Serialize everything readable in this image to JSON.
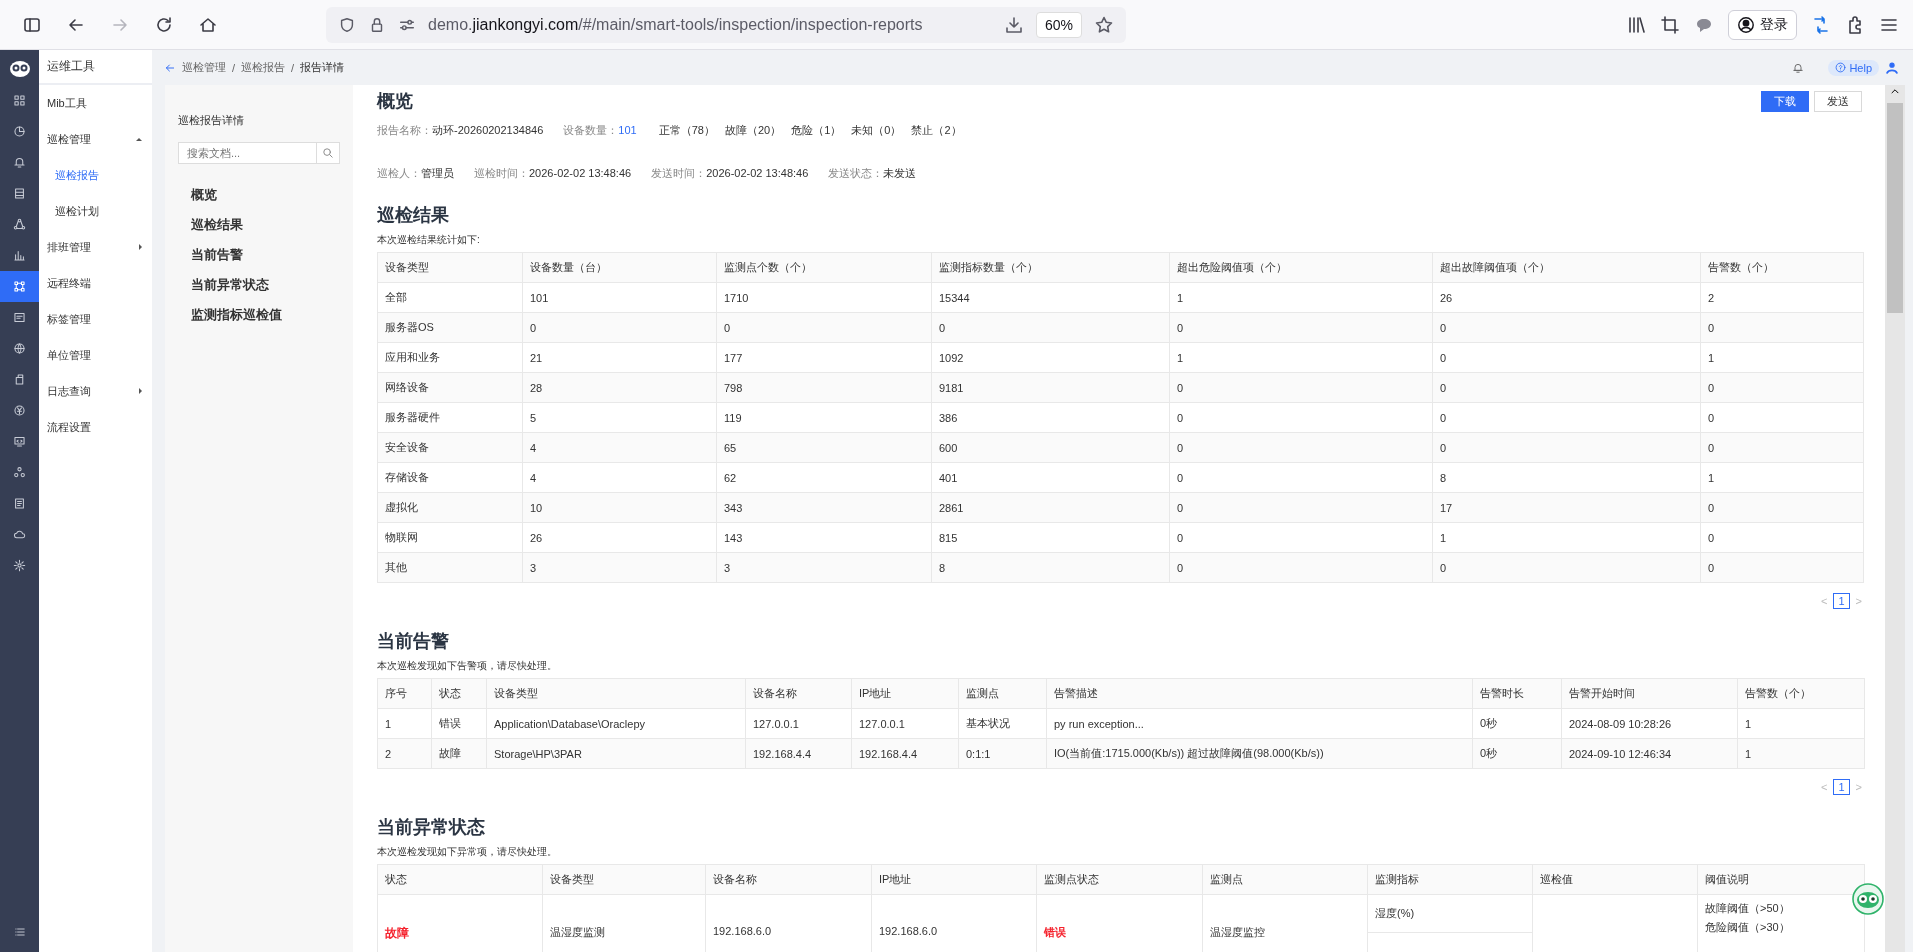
{
  "browser": {
    "url": "demo.**jiankongyi.com**/#/main/smart-tools/inspection/inspection-reports",
    "zoom": "60%",
    "login": "登录"
  },
  "rail": [
    {
      "selected": false
    },
    {
      "selected": false
    },
    {
      "selected": false
    },
    {
      "selected": false
    },
    {
      "selected": false
    },
    {
      "selected": false
    },
    {
      "selected": true
    },
    {
      "selected": false
    },
    {
      "selected": false
    },
    {
      "selected": false
    },
    {
      "selected": false
    },
    {
      "selected": false
    },
    {
      "selected": false
    },
    {
      "selected": false
    },
    {
      "selected": false
    },
    {
      "selected": false
    }
  ],
  "nav": {
    "title": "运维工具",
    "items": [
      {
        "label": "Mib工具",
        "kind": "link"
      },
      {
        "label": "巡检管理",
        "kind": "group",
        "expanded": true,
        "children": [
          {
            "label": "巡检报告",
            "selected": true
          },
          {
            "label": "巡检计划",
            "selected": false
          }
        ]
      },
      {
        "label": "排班管理",
        "kind": "group",
        "expanded": false
      },
      {
        "label": "远程终端",
        "kind": "link"
      },
      {
        "label": "标签管理",
        "kind": "link"
      },
      {
        "label": "单位管理",
        "kind": "link"
      },
      {
        "label": "日志查询",
        "kind": "group",
        "expanded": false
      },
      {
        "label": "流程设置",
        "kind": "link"
      }
    ]
  },
  "breadcrumb": {
    "separator": "/",
    "items": [
      "巡检管理",
      "巡检报告",
      "报告详情"
    ]
  },
  "help": "Help",
  "doc_nav": {
    "title": "巡检报告详情",
    "search": {
      "placeholder": "搜索文档..."
    },
    "items": [
      "概览",
      "巡检结果",
      "当前告警",
      "当前异常状态",
      "监测指标巡检值"
    ]
  },
  "overview": {
    "heading": "概览",
    "buttons": [
      {
        "label": "下载",
        "kind": "primary"
      },
      {
        "label": "发送",
        "kind": "default"
      }
    ],
    "line_1": [
      {
        "label": "报告名称：",
        "value": "动环-20260202134846",
        "kind": "text"
      },
      {
        "label": "设备数量：",
        "value": "101",
        "kind": "link"
      }
    ],
    "counts": [
      "正常（78）",
      "故障（20）",
      "危险（1）",
      "未知（0）",
      "禁止（2）"
    ],
    "line_2": [
      {
        "label": "巡检人：",
        "value": "管理员"
      },
      {
        "label": "巡检时间：",
        "value": "2026-02-02 13:48:46"
      },
      {
        "label": "发送时间：",
        "value": "2026-02-02 13:48:46"
      },
      {
        "label": "发送状态：",
        "value": "未发送"
      }
    ]
  },
  "results": {
    "heading": "巡检结果",
    "note": "本次巡检结果统计如下:",
    "columns": [
      "设备类型",
      "设备数量（台）",
      "监测点个数（个）",
      "监测指标数量（个）",
      "超出危险阈值项（个）",
      "超出故障阈值项（个）",
      "告警数（个）"
    ],
    "rows": [
      [
        "全部",
        "101",
        "1710",
        "15344",
        "1",
        "26",
        "2"
      ],
      [
        "服务器OS",
        "0",
        "0",
        "0",
        "0",
        "0",
        "0"
      ],
      [
        "应用和业务",
        "21",
        "177",
        "1092",
        "1",
        "0",
        "1"
      ],
      [
        "网络设备",
        "28",
        "798",
        "9181",
        "0",
        "0",
        "0"
      ],
      [
        "服务器硬件",
        "5",
        "119",
        "386",
        "0",
        "0",
        "0"
      ],
      [
        "安全设备",
        "4",
        "65",
        "600",
        "0",
        "0",
        "0"
      ],
      [
        "存储设备",
        "4",
        "62",
        "401",
        "0",
        "8",
        "1"
      ],
      [
        "虚拟化",
        "10",
        "343",
        "2861",
        "0",
        "17",
        "0"
      ],
      [
        "物联网",
        "26",
        "143",
        "815",
        "0",
        "1",
        "0"
      ],
      [
        "其他",
        "3",
        "3",
        "8",
        "0",
        "0",
        "0"
      ]
    ],
    "pagination": {
      "prev": "<",
      "pages": [
        {
          "label": "1",
          "selected": true
        }
      ],
      "next": ">"
    }
  },
  "alerts": {
    "heading": "当前告警",
    "note": "本次巡检发现如下告警项，请尽快处理。",
    "columns": [
      "序号",
      "状态",
      "设备类型",
      "设备名称",
      "IP地址",
      "监测点",
      "告警描述",
      "告警时长",
      "告警开始时间",
      "告警数（个）"
    ],
    "rows": [
      [
        "1",
        "错误",
        "Application\\Database\\Oraclepy",
        "127.0.0.1",
        "127.0.0.1",
        "基本状况",
        "py run exception...",
        "0秒",
        "2024-08-09 10:28:26",
        "1"
      ],
      [
        "2",
        "故障",
        "Storage\\HP\\3PAR",
        "192.168.4.4",
        "192.168.4.4",
        "0:1:1",
        "IO(当前值:1715.000(Kb/s)) 超过故障阈值(98.000(Kb/s))",
        "0秒",
        "2024-09-10 12:46:34",
        "1"
      ]
    ],
    "pagination": {
      "prev": "<",
      "pages": [
        {
          "label": "1",
          "selected": true
        }
      ],
      "next": ">"
    }
  },
  "anomalies": {
    "heading": "当前异常状态",
    "note": "本次巡检发现如下异常项，请尽快处理。",
    "columns": [
      "状态",
      "设备类型",
      "设备名称",
      "IP地址",
      "监测点状态",
      "监测点",
      "监测指标",
      "巡检值",
      "阈值说明"
    ],
    "rows": [
      {
        "status": {
          "text": "故障",
          "color": "#f5222d"
        },
        "device_type": "温湿度监测",
        "device_name": "192.168.6.0",
        "ip": "192.168.6.0",
        "point_status": {
          "text": "错误",
          "color": "#f5222d"
        },
        "point": "温湿度监控",
        "metric": "湿度(%)",
        "thresholds": [
          "故障阈值（>50）",
          "危险阈值（>30）"
        ]
      }
    ]
  }
}
